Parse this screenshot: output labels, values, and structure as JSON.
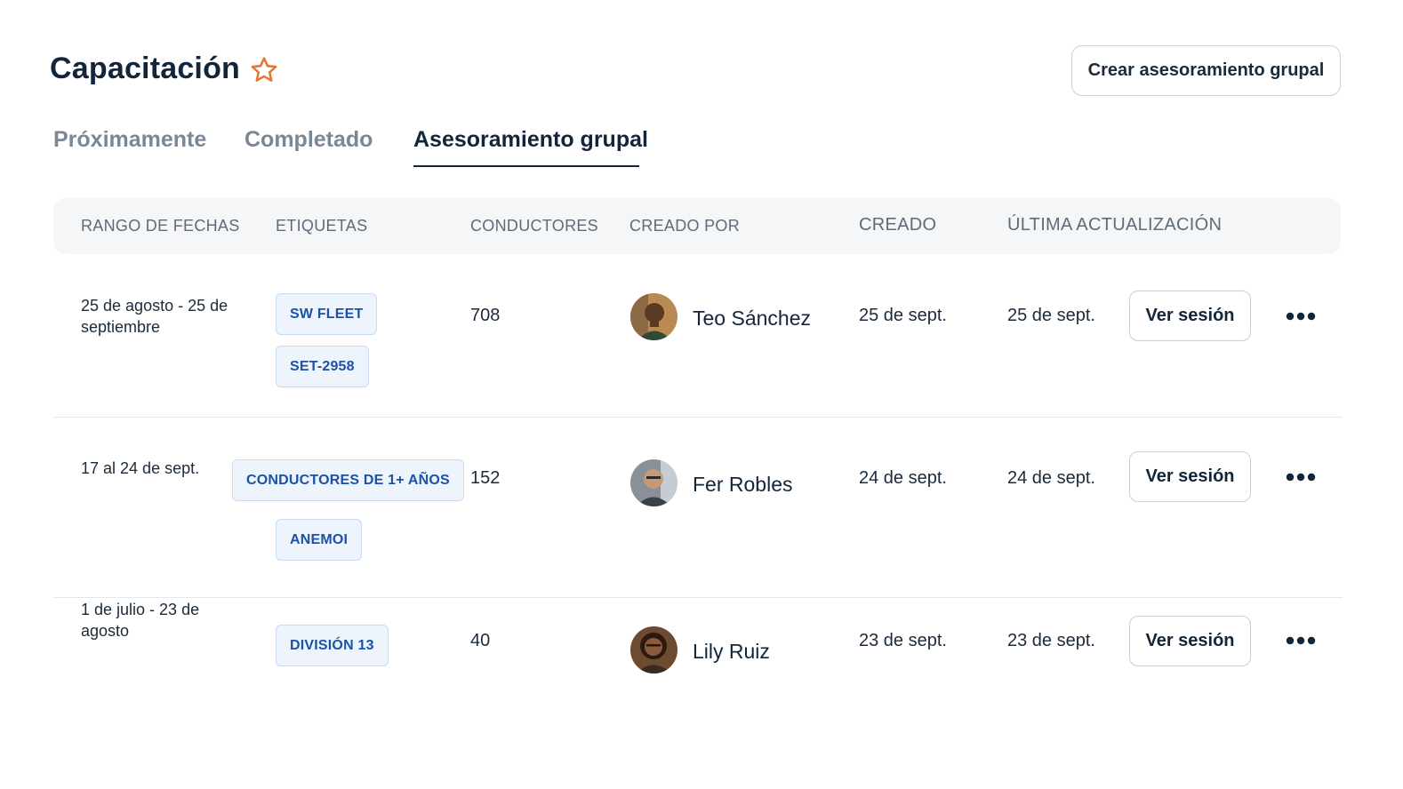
{
  "page": {
    "title": "Capacitación",
    "create_button_label": "Crear asesoramiento grupal"
  },
  "tabs": [
    {
      "label": "Próximamente",
      "active": false
    },
    {
      "label": "Completado",
      "active": false
    },
    {
      "label": "Asesoramiento grupal",
      "active": true
    }
  ],
  "table": {
    "headers": {
      "date_range": "RANGO DE FECHAS",
      "tags": "ETIQUETAS",
      "drivers": "CONDUCTORES",
      "created_by": "CREADO POR",
      "created": "CREADO",
      "last_updated": "ÚLTIMA ACTUALIZACIÓN"
    },
    "rows": [
      {
        "date_range": "25 de agosto - 25 de septiembre",
        "tags": [
          "SW FLEET",
          "SET-2958"
        ],
        "drivers": "708",
        "created_by": "Teo Sánchez",
        "created": "25 de sept.",
        "last_updated": "25 de sept.",
        "action_label": "Ver sesión"
      },
      {
        "date_range": "17 al 24 de sept.",
        "tags": [
          "CONDUCTORES DE 1+ AÑOS",
          "ANEMOI"
        ],
        "drivers": "152",
        "created_by": "Fer Robles",
        "created": "24 de sept.",
        "last_updated": "24 de sept.",
        "action_label": "Ver sesión"
      },
      {
        "date_range": "1 de julio - 23 de agosto",
        "tags": [
          "DIVISIÓN 13"
        ],
        "drivers": "40",
        "created_by": "Lily Ruiz",
        "created": "23 de sept.",
        "last_updated": "23 de sept.",
        "action_label": "Ver sesión"
      }
    ]
  },
  "colors": {
    "accent_star": "#e8772e",
    "tag_text": "#1a52a8",
    "tag_bg": "#eef4fb",
    "title": "#13253a"
  },
  "icons": {
    "favorite": "star-icon",
    "row_menu": "more-options-icon"
  }
}
